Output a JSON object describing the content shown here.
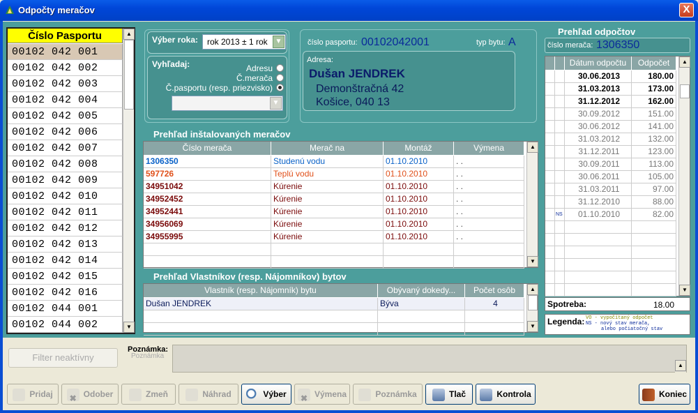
{
  "window": {
    "title": "Odpočty meračov",
    "close": "X"
  },
  "pasport_list": {
    "header": "Číslo Pasportu",
    "items": [
      "00102 042 001",
      "00102 042 002",
      "00102 042 003",
      "00102 042 004",
      "00102 042 005",
      "00102 042 006",
      "00102 042 007",
      "00102 042 008",
      "00102 042 009",
      "00102 042 010",
      "00102 042 011",
      "00102 042 012",
      "00102 042 013",
      "00102 042 014",
      "00102 042 015",
      "00102 042 016",
      "00102 044 001",
      "00102 044 002"
    ]
  },
  "year": {
    "label": "Výber roka:",
    "value": "rok 2013 ± 1 rok"
  },
  "search": {
    "label": "Vyhľadaj:",
    "opt1": "Adresu",
    "opt2": "Č.merača",
    "opt3": "Č.pasportu (resp. priezvisko)",
    "value": ""
  },
  "info": {
    "pasport_label": "číslo pasportu:",
    "pasport_value": "00102042001",
    "type_label": "typ bytu:",
    "type_value": "A",
    "address_label": "Adresa:",
    "name": "Dušan JENDREK",
    "street": "Demonštračná 42",
    "city": "Košice, 040 13"
  },
  "meters": {
    "title": "Prehľad inštalovaných meračov",
    "headers": [
      "Číslo merača",
      "Merač na",
      "Montáž",
      "Výmena"
    ],
    "rows": [
      {
        "num": "1306350",
        "type": "Studenú vodu",
        "mont": "01.10.2010",
        "vym": ". .",
        "color": "#0a62c8",
        "bold": true
      },
      {
        "num": "597726",
        "type": "Teplú vodu",
        "mont": "01.10.2010",
        "vym": ". .",
        "color": "#e0501a",
        "bold": true
      },
      {
        "num": "34951042",
        "type": "Kúrenie",
        "mont": "01.10.2010",
        "vym": ". .",
        "color": "#7a0a0a",
        "bold": true
      },
      {
        "num": "34952452",
        "type": "Kúrenie",
        "mont": "01.10.2010",
        "vym": ". .",
        "color": "#7a0a0a",
        "bold": true
      },
      {
        "num": "34952441",
        "type": "Kúrenie",
        "mont": "01.10.2010",
        "vym": ". .",
        "color": "#7a0a0a",
        "bold": true
      },
      {
        "num": "34956069",
        "type": "Kúrenie",
        "mont": "01.10.2010",
        "vym": ". .",
        "color": "#7a0a0a",
        "bold": true
      },
      {
        "num": "34955995",
        "type": "Kúrenie",
        "mont": "01.10.2010",
        "vym": ". .",
        "color": "#7a0a0a",
        "bold": true
      }
    ]
  },
  "owners": {
    "title": "Prehľad Vlastníkov (resp. Nájomníkov) bytov",
    "headers": [
      "Vlastník (resp. Nájomník) bytu",
      "Obývaný dokedy...",
      "Počet osôb"
    ],
    "rows": [
      {
        "name": "Dušan JENDREK",
        "until": "Býva",
        "count": "4"
      }
    ]
  },
  "readings": {
    "title": "Prehľad odpočtov",
    "meter_label": "číslo merača:",
    "meter_value": "1306350",
    "headers": [
      "Dátum odpočtu",
      "Odpočet"
    ],
    "rows": [
      {
        "date": "30.06.2013",
        "val": "180.00",
        "bold": true,
        "tag": ""
      },
      {
        "date": "31.03.2013",
        "val": "173.00",
        "bold": true,
        "tag": ""
      },
      {
        "date": "31.12.2012",
        "val": "162.00",
        "bold": true,
        "tag": ""
      },
      {
        "date": "30.09.2012",
        "val": "151.00",
        "bold": false,
        "tag": ""
      },
      {
        "date": "30.06.2012",
        "val": "141.00",
        "bold": false,
        "tag": ""
      },
      {
        "date": "31.03.2012",
        "val": "132.00",
        "bold": false,
        "tag": ""
      },
      {
        "date": "31.12.2011",
        "val": "123.00",
        "bold": false,
        "tag": ""
      },
      {
        "date": "30.09.2011",
        "val": "113.00",
        "bold": false,
        "tag": ""
      },
      {
        "date": "30.06.2011",
        "val": "105.00",
        "bold": false,
        "tag": ""
      },
      {
        "date": "31.03.2011",
        "val": "97.00",
        "bold": false,
        "tag": ""
      },
      {
        "date": "31.12.2010",
        "val": "88.00",
        "bold": false,
        "tag": ""
      },
      {
        "date": "01.10.2010",
        "val": "82.00",
        "bold": false,
        "tag": "NS"
      }
    ],
    "consumption_label": "Spotreba:",
    "consumption_value": "18.00",
    "legend_label": "Legenda:",
    "legend_vo": "VO - vypočítaný odpočet",
    "legend_ns": "NS - nový stav merača,",
    "legend_ns2": "alebo počiatočný stav"
  },
  "filter_btn": "Filter neaktívny",
  "note_label": "Poznámka:",
  "note_ghost": "Poznámka",
  "buttons": {
    "pridaj": "Pridaj",
    "odober": "Odober",
    "zmen": "Zmeň",
    "nahrad": "Náhrad",
    "vyber": "Výber",
    "vymena": "Výmena",
    "poznamka": "Poznámka",
    "tlac": "Tlač",
    "kontrola": "Kontrola",
    "koniec": "Koniec"
  }
}
